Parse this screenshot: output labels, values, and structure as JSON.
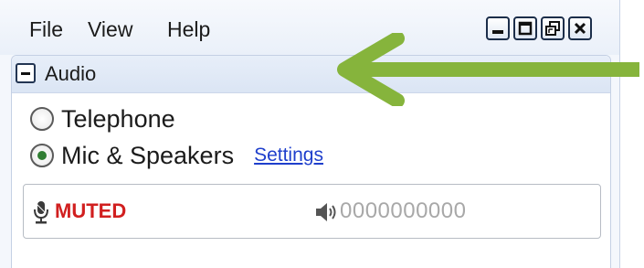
{
  "menubar": {
    "items": [
      {
        "label": "File"
      },
      {
        "label": "View"
      },
      {
        "label": "Help"
      }
    ]
  },
  "window_controls": [
    {
      "icon": "minimize-icon"
    },
    {
      "icon": "maximize-icon"
    },
    {
      "icon": "restore-icon"
    },
    {
      "icon": "close-icon"
    }
  ],
  "audio": {
    "title": "Audio",
    "collapse_icon": "minus-icon",
    "options": [
      {
        "label": "Telephone",
        "selected": false
      },
      {
        "label": "Mic & Speakers",
        "selected": true
      }
    ],
    "settings_link": "Settings",
    "status": {
      "mic_icon": "microphone-icon",
      "muted_text": "MUTED",
      "speaker_icon": "speaker-icon",
      "volume_meter": "0000000000"
    }
  },
  "annotation": {
    "icon": "green-arrow-icon",
    "color": "#86b43c"
  },
  "colors": {
    "muted": "#d11f1f",
    "link": "#1f3fcc",
    "radio_selected": "#2f7d32"
  }
}
